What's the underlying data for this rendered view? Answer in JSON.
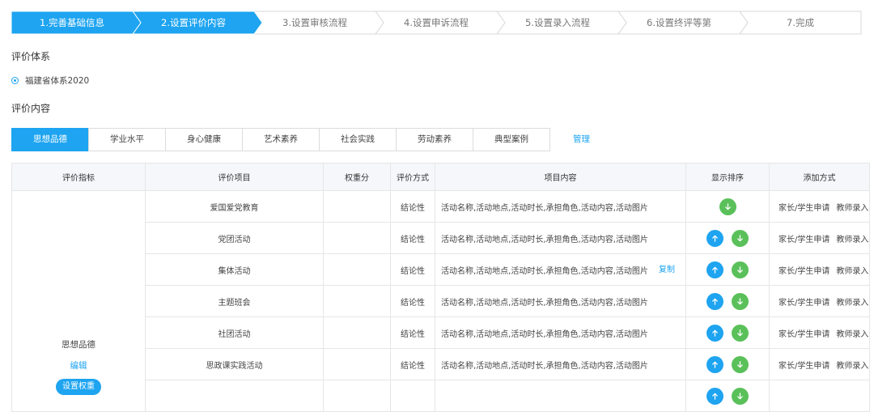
{
  "steps": [
    {
      "label": "1.完善基础信息",
      "state": "done"
    },
    {
      "label": "2.设置评价内容",
      "state": "current"
    },
    {
      "label": "3.设置审核流程",
      "state": "todo"
    },
    {
      "label": "4.设置申诉流程",
      "state": "todo"
    },
    {
      "label": "5.设置录入流程",
      "state": "todo"
    },
    {
      "label": "6.设置终评等第",
      "state": "todo"
    },
    {
      "label": "7.完成",
      "state": "todo"
    }
  ],
  "system_section": {
    "title": "评价体系",
    "selected_system": "福建省体系2020"
  },
  "content_section": {
    "title": "评价内容"
  },
  "tabs": [
    "思想品德",
    "学业水平",
    "身心健康",
    "艺术素养",
    "社会实践",
    "劳动素养",
    "典型案例"
  ],
  "active_tab": "思想品德",
  "manage_link": "管理",
  "table": {
    "headers": [
      "评价指标",
      "评价项目",
      "权重分",
      "评价方式",
      "项目内容",
      "显示排序",
      "添加方式"
    ],
    "indicator": {
      "name": "思想品德",
      "edit_label": "编辑",
      "weight_button": "设置权重"
    },
    "copy_label": "复制",
    "rows": [
      {
        "item": "爱国爱党教育",
        "weight": "",
        "method": "结论性",
        "content": "活动名称,活动地点,活动时长,承担角色,活动内容,活动图片",
        "up": false,
        "down": true,
        "add_methods": [
          "家长/学生申请",
          "教师录入"
        ]
      },
      {
        "item": "党团活动",
        "weight": "",
        "method": "结论性",
        "content": "活动名称,活动地点,活动时长,承担角色,活动内容,活动图片",
        "up": true,
        "down": true,
        "add_methods": [
          "家长/学生申请",
          "教师录入"
        ]
      },
      {
        "item": "集体活动",
        "weight": "",
        "method": "结论性",
        "content": "活动名称,活动地点,活动时长,承担角色,活动内容,活动图片",
        "up": true,
        "down": true,
        "add_methods": [
          "家长/学生申请",
          "教师录入"
        ],
        "show_copy": true
      },
      {
        "item": "主题班会",
        "weight": "",
        "method": "结论性",
        "content": "活动名称,活动地点,活动时长,承担角色,活动内容,活动图片",
        "up": true,
        "down": true,
        "add_methods": [
          "家长/学生申请",
          "教师录入"
        ]
      },
      {
        "item": "社团活动",
        "weight": "",
        "method": "结论性",
        "content": "活动名称,活动地点,活动时长,承担角色,活动内容,活动图片",
        "up": true,
        "down": true,
        "add_methods": [
          "家长/学生申请",
          "教师录入"
        ]
      },
      {
        "item": "思政课实践活动",
        "weight": "",
        "method": "结论性",
        "content": "活动名称,活动地点,活动时长,承担角色,活动内容,活动图片",
        "up": true,
        "down": true,
        "add_methods": [
          "家长/学生申请",
          "教师录入"
        ]
      },
      {
        "item": "",
        "weight": "",
        "method": "",
        "content": "",
        "up": true,
        "down": true,
        "add_methods": []
      }
    ]
  },
  "colors": {
    "accent": "#1ea4f0",
    "down_button": "#5ac05a",
    "border": "#e6e6e6",
    "header_bg": "#f5f7fa"
  },
  "icons": {
    "up": "arrow-up-icon",
    "down": "arrow-down-icon"
  }
}
